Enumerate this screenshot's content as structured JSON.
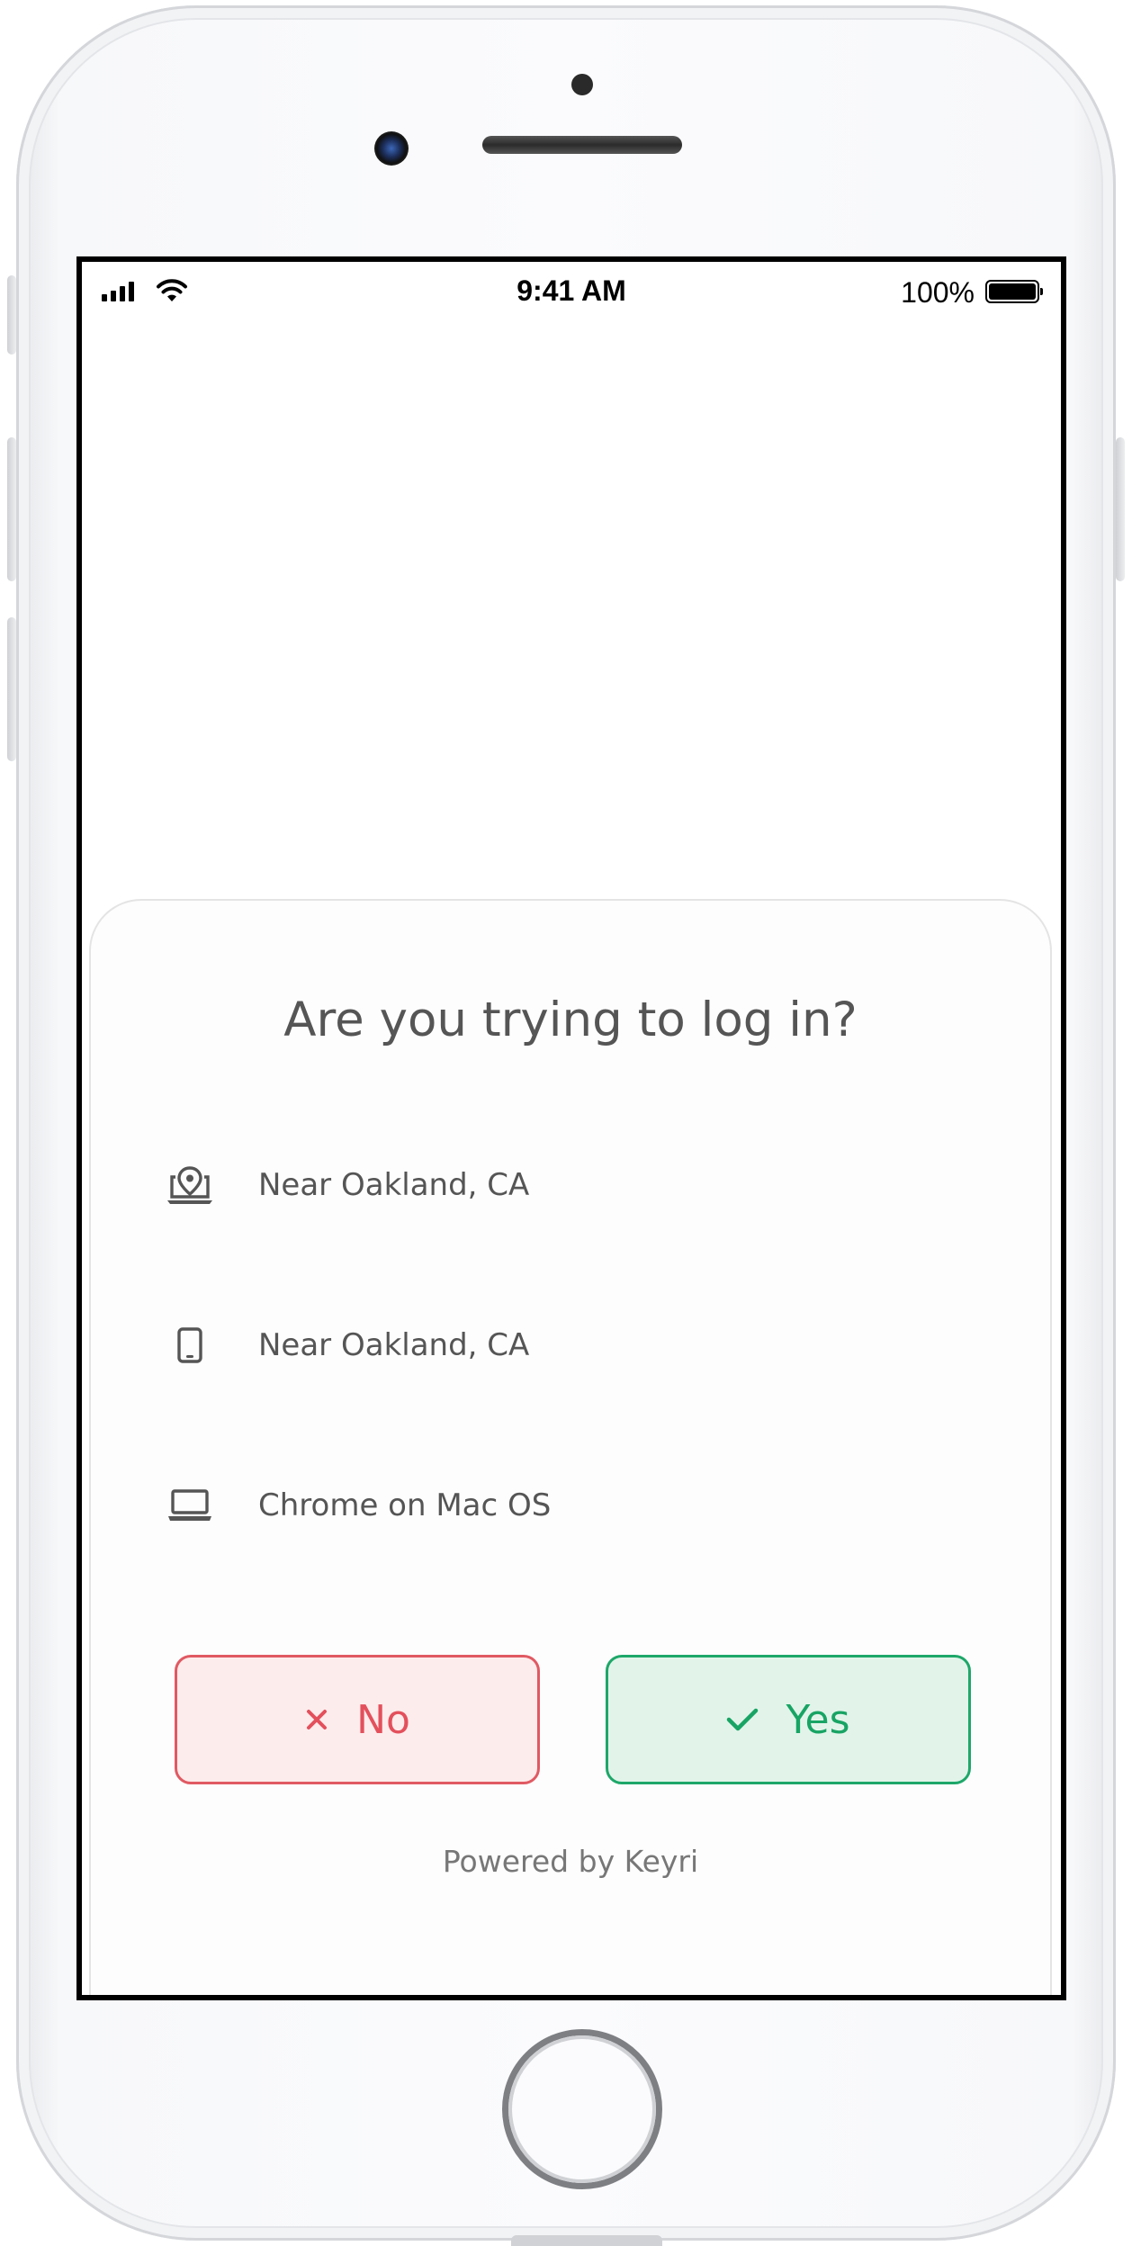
{
  "status_bar": {
    "time": "9:41 AM",
    "battery_percent": "100%"
  },
  "dialog": {
    "title": "Are you trying to log in?",
    "rows": [
      {
        "icon": "location-laptop-icon",
        "text": "Near Oakland, CA"
      },
      {
        "icon": "phone-icon",
        "text": "Near Oakland, CA"
      },
      {
        "icon": "laptop-icon",
        "text": "Chrome on Mac OS"
      }
    ],
    "no_button": {
      "label": "No",
      "icon": "x-icon",
      "color": "#e3505c"
    },
    "yes_button": {
      "label": "Yes",
      "icon": "check-icon",
      "color": "#18a464"
    },
    "footer": "Powered by Keyri"
  }
}
